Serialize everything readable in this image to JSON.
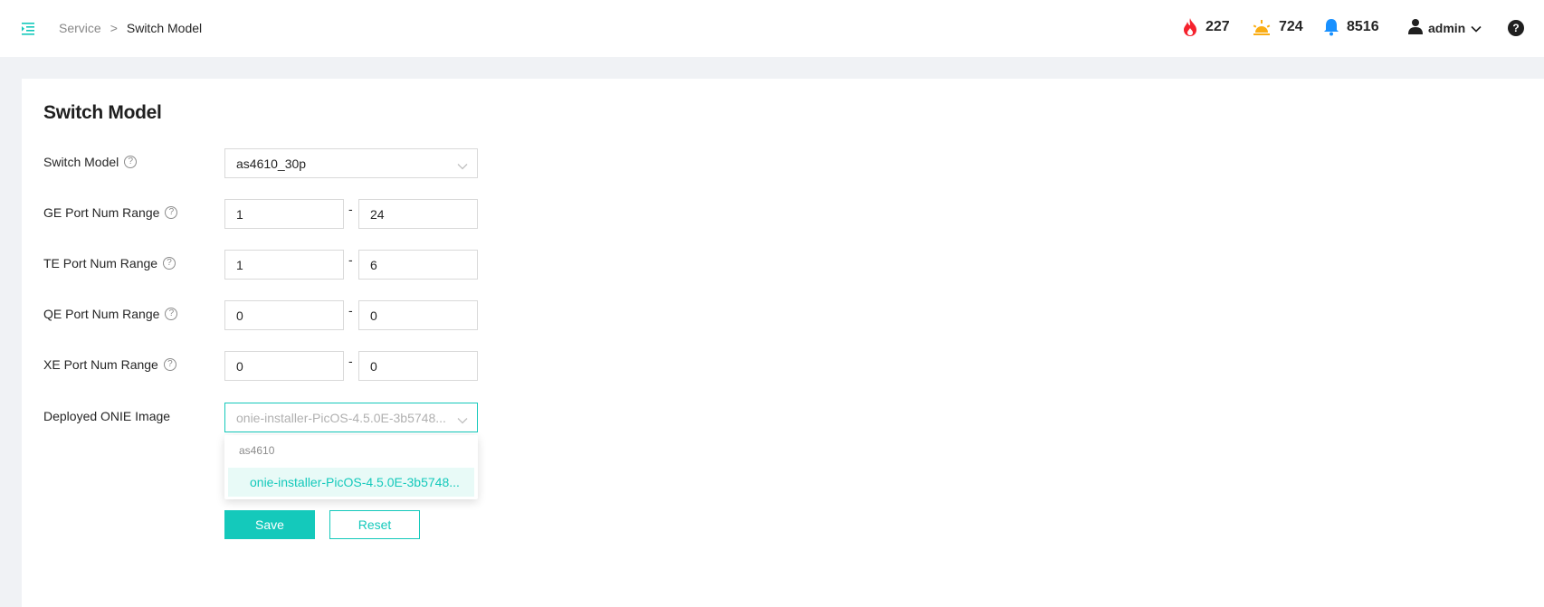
{
  "header": {
    "breadcrumb": {
      "parent": "Service",
      "separator": ">",
      "current": "Switch Model"
    },
    "stats": [
      {
        "icon": "fire-icon",
        "value": "227",
        "color": "#f5222d"
      },
      {
        "icon": "sun-alert-icon",
        "value": "724",
        "color": "#faad14"
      },
      {
        "icon": "bell-icon",
        "value": "8516",
        "color": "#1890ff"
      }
    ],
    "user": {
      "name": "admin",
      "icon": "user-icon"
    },
    "help": "?"
  },
  "page": {
    "title": "Switch Model"
  },
  "form": {
    "switch_model": {
      "label": "Switch Model",
      "value": "as4610_30p"
    },
    "ge_range": {
      "label": "GE Port Num Range",
      "from": "1",
      "to": "24"
    },
    "te_range": {
      "label": "TE Port Num Range",
      "from": "1",
      "to": "6"
    },
    "qe_range": {
      "label": "QE Port Num Range",
      "from": "0",
      "to": "0"
    },
    "xe_range": {
      "label": "XE Port Num Range",
      "from": "0",
      "to": "0"
    },
    "range_separator": "-",
    "onie_image": {
      "label": "Deployed ONIE Image",
      "placeholder": "onie-installer-PicOS-4.5.0E-3b5748..."
    }
  },
  "dropdown": {
    "group_label": "as4610",
    "options": [
      "onie-installer-PicOS-4.5.0E-3b5748..."
    ]
  },
  "actions": {
    "save": "Save",
    "reset": "Reset"
  },
  "colors": {
    "accent": "#14c9bb",
    "background": "#f0f2f5"
  }
}
